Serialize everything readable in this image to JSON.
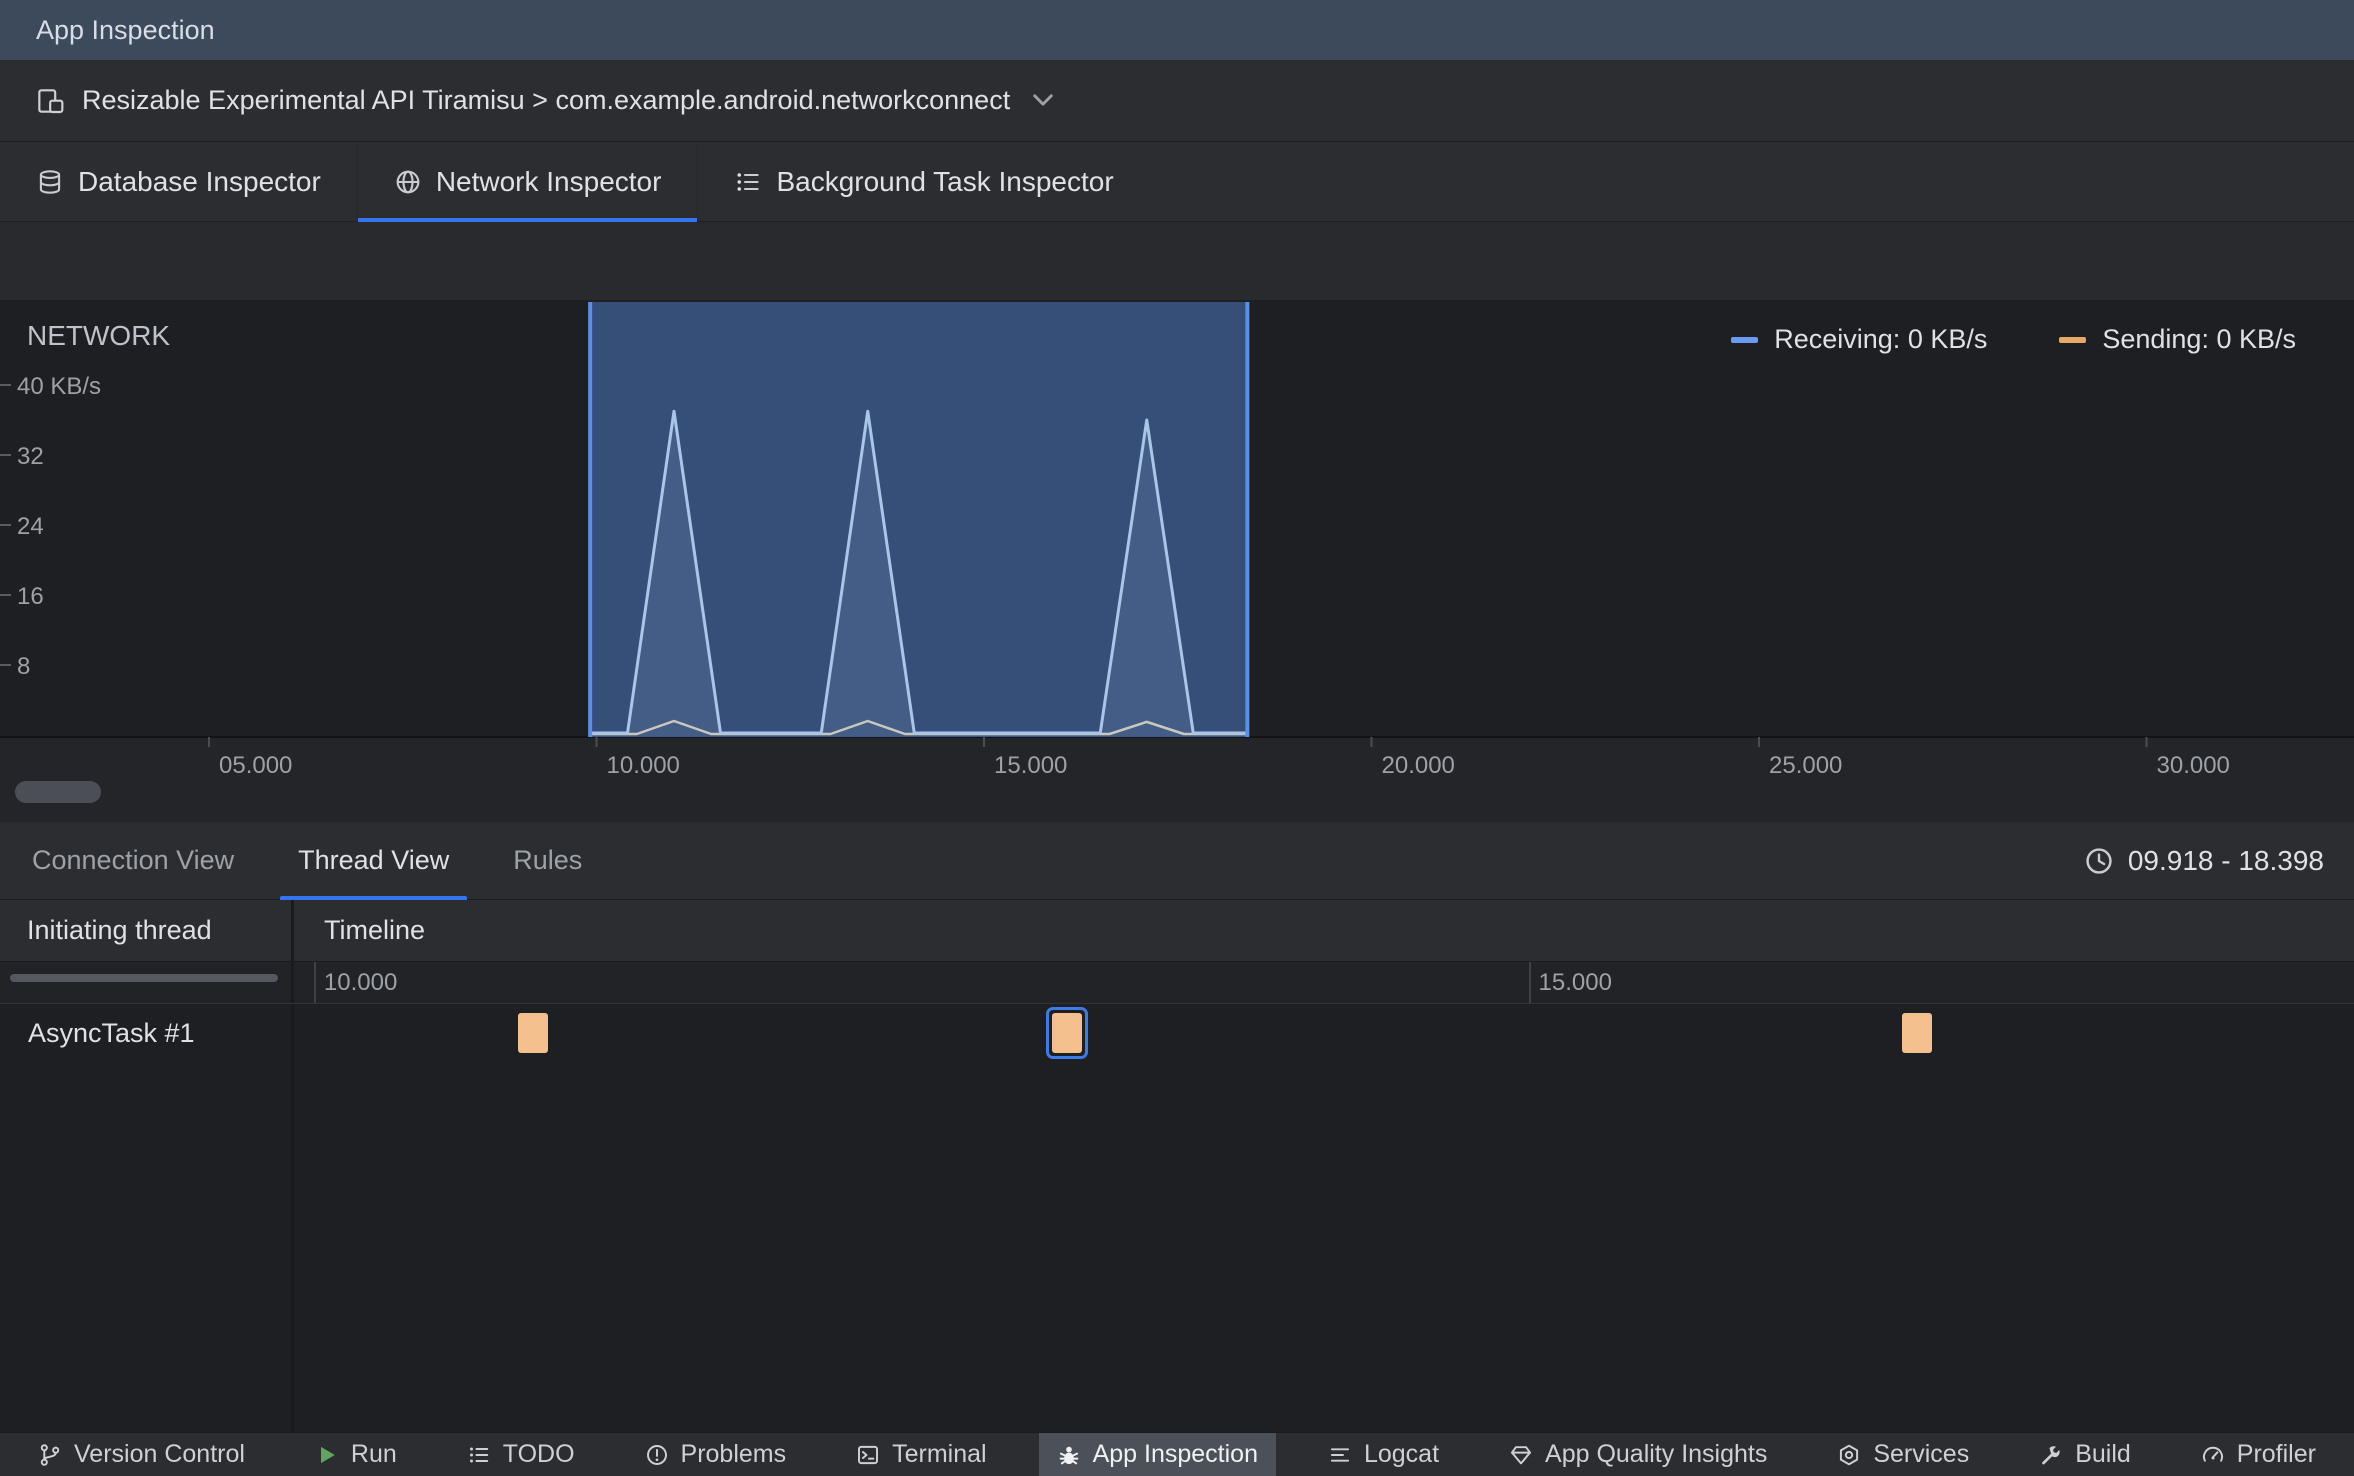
{
  "window_title": "App Inspection",
  "process_bar": {
    "label": "Resizable Experimental API Tiramisu > com.example.android.networkconnect"
  },
  "inspector_tabs": {
    "database": {
      "label": "Database Inspector"
    },
    "network": {
      "label": "Network Inspector"
    },
    "background": {
      "label": "Background Task Inspector"
    }
  },
  "chart_data": {
    "type": "area",
    "title": "NETWORK",
    "ylim": [
      0,
      40
    ],
    "yticks": [
      {
        "value": 40,
        "label": "40 KB/s"
      },
      {
        "value": 32,
        "label": "32"
      },
      {
        "value": 24,
        "label": "24"
      },
      {
        "value": 16,
        "label": "16"
      },
      {
        "value": 8,
        "label": "8"
      }
    ],
    "xticks": [
      {
        "t": 5,
        "label": "05.000"
      },
      {
        "t": 10,
        "label": "10.000"
      },
      {
        "t": 15,
        "label": "15.000"
      },
      {
        "t": 20,
        "label": "20.000"
      },
      {
        "t": 25,
        "label": "25.000"
      },
      {
        "t": 30,
        "label": "30.000"
      }
    ],
    "selection": {
      "start": 9.918,
      "end": 18.398
    },
    "base_halfwidth_s": 0.6,
    "series": [
      {
        "name": "Receiving",
        "legend": "Receiving: 0 KB/s",
        "color": "#6A9BEE",
        "line_color": "#A9C6E9",
        "spikes": [
          {
            "t": 11.0,
            "peak": 37
          },
          {
            "t": 13.5,
            "peak": 37
          },
          {
            "t": 17.1,
            "peak": 36
          }
        ]
      },
      {
        "name": "Sending",
        "legend": "Sending: 0 KB/s",
        "color": "#E8A968",
        "line_color": "#CFC8BA",
        "spikes": [
          {
            "t": 11.0,
            "peak": 1.6
          },
          {
            "t": 13.5,
            "peak": 1.6
          },
          {
            "t": 17.1,
            "peak": 1.5
          }
        ]
      }
    ],
    "selection_fill": "#3E649E",
    "selection_edge": "#5B8FE8"
  },
  "detail_tabs": {
    "connection": {
      "label": "Connection View"
    },
    "thread": {
      "label": "Thread View"
    },
    "rules": {
      "label": "Rules"
    }
  },
  "time_range": "09.918 - 18.398",
  "thread_table": {
    "columns": [
      "Initiating thread",
      "Timeline"
    ],
    "scale": [
      {
        "t": 10,
        "label": "10.000"
      },
      {
        "t": 15,
        "label": "15.000"
      }
    ],
    "rows": [
      {
        "thread": "AsyncTask #1",
        "events": [
          {
            "t": 10.9,
            "selected": false
          },
          {
            "t": 13.1,
            "selected": true
          },
          {
            "t": 16.6,
            "selected": false
          }
        ]
      }
    ],
    "block_color": "#F3C08E",
    "selected_border": "#3D7BE8"
  },
  "status_bar": {
    "items": [
      {
        "label": "Version Control",
        "icon": "branch-icon",
        "selected": false
      },
      {
        "label": "Run",
        "icon": "run-icon",
        "selected": false
      },
      {
        "label": "TODO",
        "icon": "todo-icon",
        "selected": false
      },
      {
        "label": "Problems",
        "icon": "problems-icon",
        "selected": false
      },
      {
        "label": "Terminal",
        "icon": "terminal-icon",
        "selected": false
      },
      {
        "label": "App Inspection",
        "icon": "app-inspection-icon",
        "selected": true
      },
      {
        "label": "Logcat",
        "icon": "logcat-icon",
        "selected": false
      },
      {
        "label": "App Quality Insights",
        "icon": "insights-icon",
        "selected": false
      },
      {
        "label": "Services",
        "icon": "services-icon",
        "selected": false
      },
      {
        "label": "Build",
        "icon": "build-icon",
        "selected": false
      },
      {
        "label": "Profiler",
        "icon": "profiler-icon",
        "selected": false
      }
    ]
  },
  "colors": {
    "titlebar": "#3C4A5C",
    "panel": "#2B2D30",
    "canvas": "#1E1F22",
    "accent": "#3574F0",
    "text": "#DFE1E5",
    "muted_text": "#9DA1A8"
  }
}
